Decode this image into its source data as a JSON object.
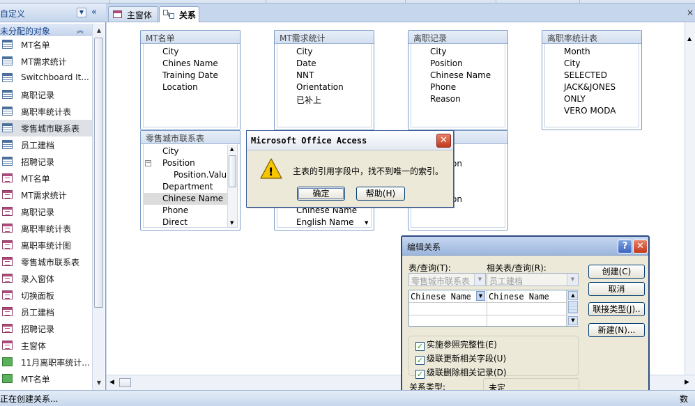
{
  "nav": {
    "header": "自定义",
    "collapse_glyph": "«",
    "group": "未分配的对象",
    "group_glyph": "⌃",
    "items": [
      {
        "label": "MT名单",
        "icon": "table-icon",
        "type": "tbl"
      },
      {
        "label": "MT需求统计",
        "icon": "table-icon",
        "type": "tbl"
      },
      {
        "label": "Switchboard It...",
        "icon": "table-icon",
        "type": "tbl"
      },
      {
        "label": "离职记录",
        "icon": "table-icon",
        "type": "tbl"
      },
      {
        "label": "离职率统计表",
        "icon": "table-icon",
        "type": "tbl"
      },
      {
        "label": "零售城市联系表",
        "icon": "table-icon",
        "type": "tbl",
        "selected": true
      },
      {
        "label": "员工建档",
        "icon": "table-icon",
        "type": "tbl"
      },
      {
        "label": "招聘记录",
        "icon": "table-icon",
        "type": "tbl"
      },
      {
        "label": "MT名单",
        "icon": "form-icon",
        "type": "frm"
      },
      {
        "label": "MT需求统计",
        "icon": "form-icon",
        "type": "frm"
      },
      {
        "label": "离职记录",
        "icon": "form-icon",
        "type": "frm"
      },
      {
        "label": "离职率统计表",
        "icon": "form-icon",
        "type": "frm"
      },
      {
        "label": "离职率统计图",
        "icon": "form-icon",
        "type": "frm"
      },
      {
        "label": "零售城市联系表",
        "icon": "form-icon",
        "type": "frm"
      },
      {
        "label": "录入窗体",
        "icon": "form-icon",
        "type": "frm"
      },
      {
        "label": "切换面板",
        "icon": "form-icon",
        "type": "frm"
      },
      {
        "label": "员工建档",
        "icon": "form-icon",
        "type": "frm"
      },
      {
        "label": "招聘记录",
        "icon": "form-icon",
        "type": "frm"
      },
      {
        "label": "主窗体",
        "icon": "form-icon",
        "type": "frm"
      },
      {
        "label": "11月离职率统计...",
        "icon": "report-icon",
        "type": "rpt"
      },
      {
        "label": "MT名单",
        "icon": "report-icon",
        "type": "rpt"
      }
    ]
  },
  "tabs": {
    "main": "主窗体",
    "relations": "关系",
    "close_glyph": "×"
  },
  "tables": {
    "mt_list": {
      "title": "MT名单",
      "fields": [
        "City",
        "Chines Name",
        "Training Date",
        "Location"
      ]
    },
    "mt_demand": {
      "title": "MT需求统计",
      "fields": [
        "City",
        "Date",
        "NNT",
        "Orientation",
        "已补上"
      ]
    },
    "resign_log": {
      "title": "离职记录",
      "fields": [
        "City",
        "Position",
        "Chinese Name",
        "Phone",
        "Reason"
      ]
    },
    "resign_rate": {
      "title": "离职率统计表",
      "fields": [
        "Month",
        "City",
        "SELECTED",
        "JACK&JONES",
        "ONLY",
        "VERO MODA"
      ]
    },
    "retail_city": {
      "title": "零售城市联系表",
      "fields": [
        "City",
        "Position",
        "Position.Valu",
        "Department",
        "Chinese Name",
        "Phone",
        "Direct"
      ],
      "expander": "−"
    },
    "hidden_middle": {
      "fields": [
        "Chinese Name",
        "English Name"
      ]
    },
    "hidden_right": {
      "fields": [
        "on",
        "on"
      ]
    }
  },
  "message_box": {
    "title": "Microsoft Office Access",
    "icon": "warning-icon",
    "exclamation": "!",
    "text": "主表的引用字段中，找不到唯一的索引。",
    "ok": "确定",
    "help": "帮助(H)",
    "close_glyph": "✕"
  },
  "edit_relation": {
    "title": "编辑关系",
    "help_glyph": "?",
    "close_glyph": "✕",
    "table_label": "表/查询(T):",
    "related_label": "相关表/查询(R):",
    "table_value": "零售城市联系表",
    "related_value": "员工建档",
    "field_left": "Chinese Name",
    "field_right": "Chinese Name",
    "enforce": "实施参照完整性(E)",
    "cascade_update": "级联更新相关字段(U)",
    "cascade_delete": "级联删除相关记录(D)",
    "check_glyph": "✓",
    "type_label": "关系类型:",
    "type_value": "未定",
    "create": "创建(C)",
    "cancel": "取消",
    "join_type": "联接类型(J)..",
    "new": "新建(N)..."
  },
  "status": {
    "left": "正在创建关系...",
    "right": "数字"
  },
  "colors": {
    "accent": "#15428b",
    "frame": "#c6d6ec",
    "dialog": "#ece9d8"
  }
}
